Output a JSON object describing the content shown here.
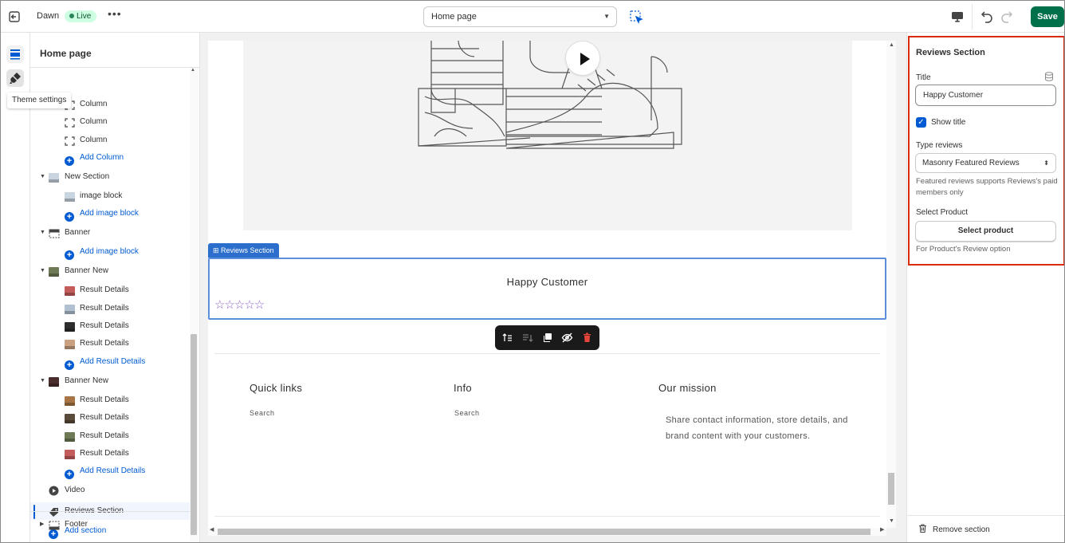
{
  "topbar": {
    "theme_name": "Dawn",
    "live_badge": "Live",
    "more": "•••",
    "page_select": "Home page",
    "save_label": "Save"
  },
  "rail": {
    "tooltip": "Theme settings"
  },
  "sidebar": {
    "title": "Home page",
    "rows": [
      {
        "label": "Column",
        "kind": "block"
      },
      {
        "label": "Column",
        "kind": "block"
      },
      {
        "label": "Column",
        "kind": "block"
      },
      {
        "label": "Add Column",
        "kind": "add"
      },
      {
        "label": "New Section",
        "kind": "section"
      },
      {
        "label": "image block",
        "kind": "block"
      },
      {
        "label": "Add image block",
        "kind": "add"
      },
      {
        "label": "Banner",
        "kind": "section"
      },
      {
        "label": "Add image block",
        "kind": "add"
      },
      {
        "label": "Banner New",
        "kind": "section"
      },
      {
        "label": "Result Details",
        "kind": "block"
      },
      {
        "label": "Result Details",
        "kind": "block"
      },
      {
        "label": "Result Details",
        "kind": "block"
      },
      {
        "label": "Result Details",
        "kind": "block"
      },
      {
        "label": "Add Result Details",
        "kind": "add"
      },
      {
        "label": "Banner New",
        "kind": "section"
      },
      {
        "label": "Result Details",
        "kind": "block"
      },
      {
        "label": "Result Details",
        "kind": "block"
      },
      {
        "label": "Result Details",
        "kind": "block"
      },
      {
        "label": "Result Details",
        "kind": "block"
      },
      {
        "label": "Add Result Details",
        "kind": "add"
      },
      {
        "label": "Video",
        "kind": "section"
      },
      {
        "label": "Reviews Section",
        "kind": "section",
        "selected": true
      },
      {
        "label": "Add section",
        "kind": "add-section"
      }
    ],
    "footer": "Footer"
  },
  "preview": {
    "section_tag": "Reviews Section",
    "reviews_heading": "Happy Customer",
    "stars": "☆☆☆☆☆",
    "footer": {
      "quick_links_heading": "Quick links",
      "quick_links_item": "Search",
      "info_heading": "Info",
      "info_item": "Search",
      "mission_heading": "Our mission",
      "mission_text": "Share contact information, store details, and brand content with your customers."
    }
  },
  "settings": {
    "title": "Reviews Section",
    "title_label": "Title",
    "title_value": "Happy Customer",
    "show_title_label": "Show title",
    "show_title_checked": true,
    "type_label": "Type reviews",
    "type_value": "Masonry Featured Reviews",
    "type_help": "Featured reviews supports Reviews's paid members only",
    "product_label": "Select Product",
    "product_button": "Select product",
    "product_help": "For Product's Review option",
    "remove_label": "Remove section"
  },
  "colors": {
    "accent": "#005bd3",
    "save_green": "#00704a",
    "highlight_red": "#d72c0d",
    "star_purple": "#8e63c4"
  }
}
